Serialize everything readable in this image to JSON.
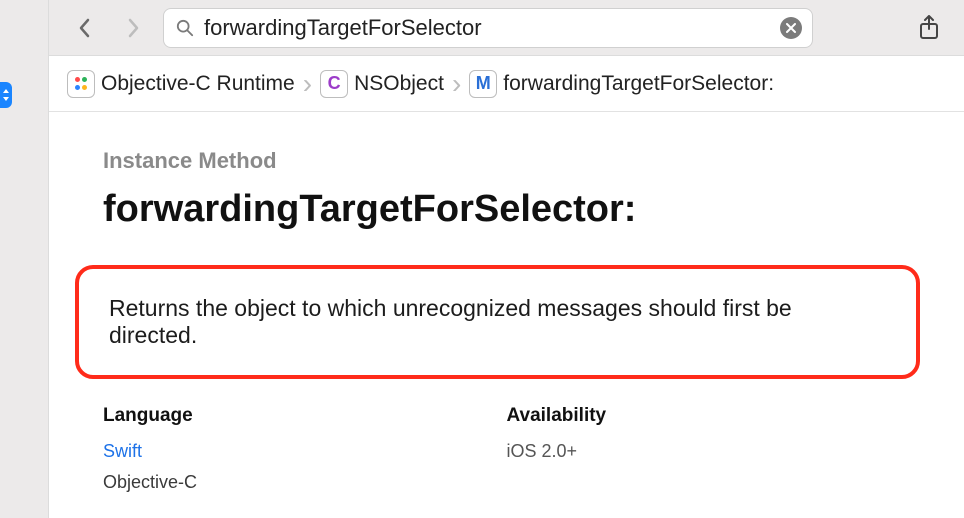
{
  "search": {
    "value": "forwardingTargetForSelector"
  },
  "breadcrumb": {
    "framework": "Objective-C Runtime",
    "class_badge": "C",
    "class": "NSObject",
    "method_badge": "M",
    "method": "forwardingTargetForSelector:"
  },
  "doc": {
    "kind": "Instance Method",
    "title": "forwardingTargetForSelector:",
    "summary": "Returns the object to which unrecognized messages should first be directed."
  },
  "language": {
    "heading": "Language",
    "link": "Swift",
    "current": "Objective-C"
  },
  "availability": {
    "heading": "Availability",
    "items": [
      "iOS 2.0+"
    ]
  }
}
